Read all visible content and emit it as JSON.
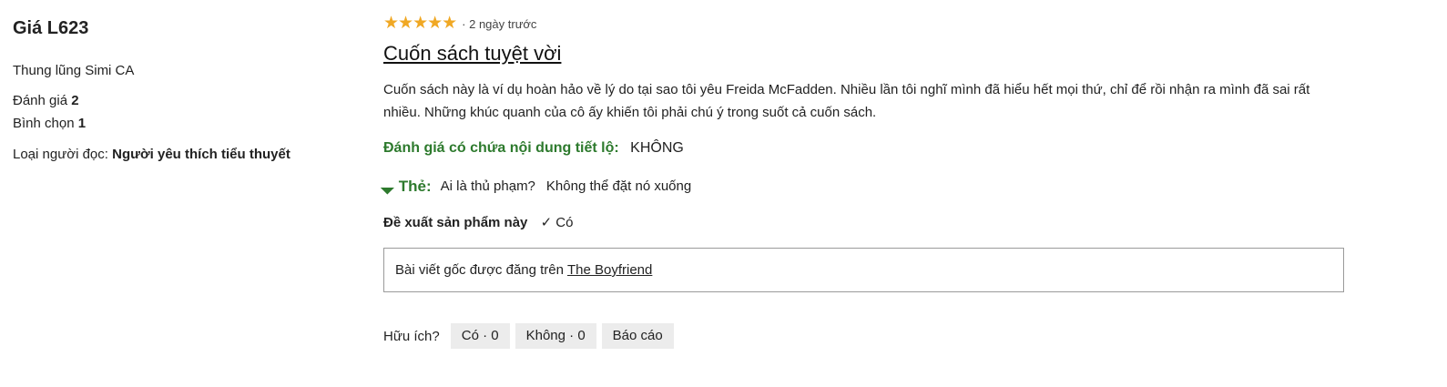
{
  "reviewer": {
    "name": "Giá L623",
    "location": "Thung lũng Simi CA",
    "reviews_label": "Đánh giá",
    "reviews_count": "2",
    "votes_label": "Bình chọn",
    "votes_count": "1",
    "reader_type_label": "Loại người đọc:",
    "reader_type_value": "Người yêu thích tiểu thuyết"
  },
  "review": {
    "stars": "★★★★★",
    "rating": 5,
    "time_ago": "· 2 ngày trước",
    "title": "Cuốn sách tuyệt vời",
    "body": "Cuốn sách này là ví dụ hoàn hảo về lý do tại sao tôi yêu Freida McFadden. Nhiều lần tôi nghĩ mình đã hiểu hết mọi thứ, chỉ để rồi nhận ra mình đã sai rất nhiều. Những khúc quanh của cô ấy khiến tôi phải chú ý trong suốt cả cuốn sách.",
    "spoiler_label": "Đánh giá có chứa nội dung tiết lộ:",
    "spoiler_value": "KHÔNG",
    "tags_label": "Thẻ:",
    "tags": [
      "Ai là thủ phạm?",
      "Không thể đặt nó xuống"
    ],
    "recommend_label": "Đề xuất sản phẩm này",
    "recommend_value": "✓ Có",
    "origin_text": "Bài viết gốc được đăng trên",
    "origin_link": "The Boyfriend"
  },
  "actions": {
    "helpful_label": "Hữu ích?",
    "yes_button": "Có · 0",
    "no_button": "Không · 0",
    "report_button": "Báo cáo"
  },
  "colors": {
    "stars": "#f0a824",
    "accent_green": "#2d7a2d"
  },
  "icons": {
    "tag": "tag-icon"
  }
}
